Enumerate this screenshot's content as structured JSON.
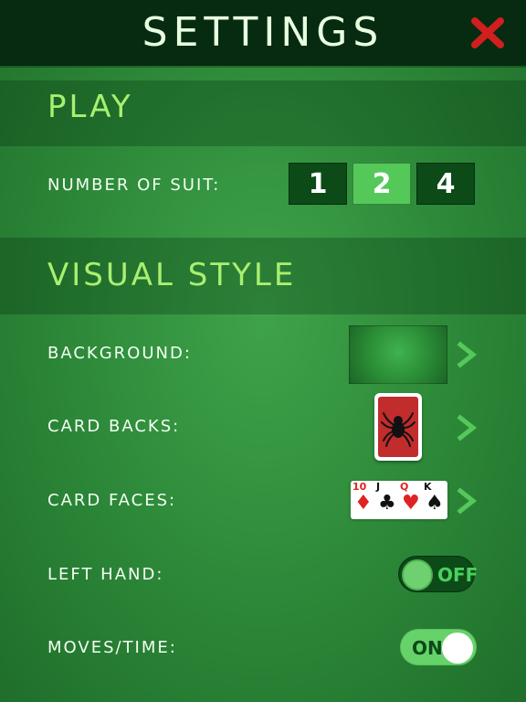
{
  "header": {
    "title": "SETTINGS",
    "close_icon": "close-x-icon"
  },
  "sections": {
    "play": {
      "title": "PLAY",
      "number_of_suit": {
        "label": "NUMBER OF SUIT:",
        "options": [
          "1",
          "2",
          "4"
        ],
        "selected": "2"
      }
    },
    "visual_style": {
      "title": "VISUAL STYLE",
      "background": {
        "label": "BACKGROUND:"
      },
      "card_backs": {
        "label": "CARD BACKS:",
        "icon": "spider-icon"
      },
      "card_faces": {
        "label": "CARD FACES:",
        "ranks": [
          "10",
          "J",
          "Q",
          "K"
        ]
      },
      "left_hand": {
        "label": "LEFT HAND:",
        "state": "OFF"
      },
      "moves_time": {
        "label": "MOVES/TIME:",
        "state": "ON"
      }
    }
  },
  "colors": {
    "accent_green": "#a8f06f",
    "selected_button": "#54c95a",
    "dark_bar": "#062b10",
    "close_red": "#d11f1f",
    "chevron_green": "#54c95a"
  }
}
